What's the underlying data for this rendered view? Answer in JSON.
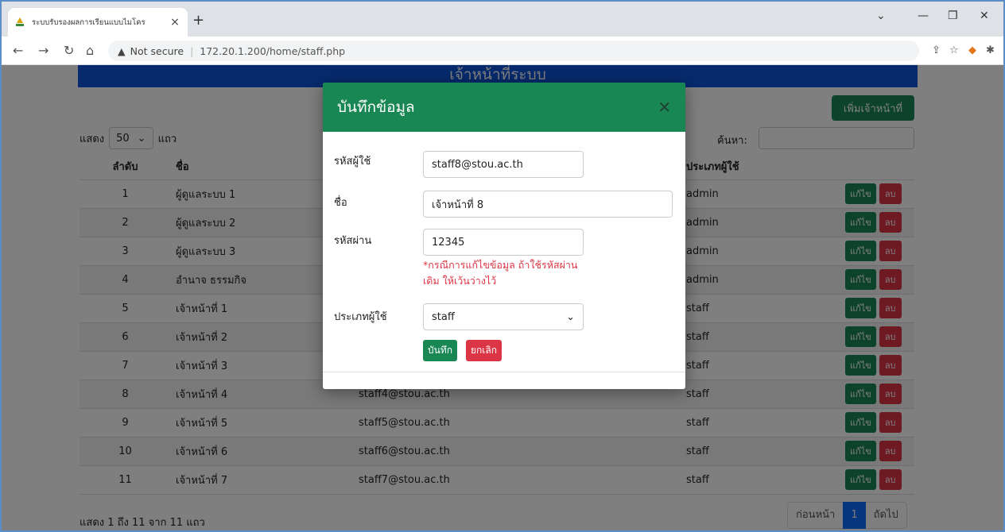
{
  "browser": {
    "tab_title": "ระบบรับรองผลการเรียนแบบไมโคร",
    "not_secure": "Not secure",
    "url": "172.20.1.200/home/staff.php"
  },
  "page": {
    "banner": "เจ้าหน้าที่ระบบ",
    "add_button": "เพิ่มเจ้าหน้าที่",
    "show_label": "แสดง",
    "page_length": "50",
    "rows_label": "แถว",
    "search_label": "ค้นหา:",
    "columns": [
      "ลำดับ",
      "ชื่อ",
      "",
      "ประเภทผู้ใช้"
    ],
    "edit_label": "แก้ไข",
    "delete_label": "ลบ",
    "rows": [
      {
        "no": "1",
        "name": "ผู้ดูแลระบบ 1",
        "email": "",
        "type": "admin"
      },
      {
        "no": "2",
        "name": "ผู้ดูแลระบบ 2",
        "email": "",
        "type": "admin"
      },
      {
        "no": "3",
        "name": "ผู้ดูแลระบบ 3",
        "email": "",
        "type": "admin"
      },
      {
        "no": "4",
        "name": "อำนาจ ธรรมกิจ",
        "email": "",
        "type": "admin"
      },
      {
        "no": "5",
        "name": "เจ้าหน้าที่ 1",
        "email": "",
        "type": "staff"
      },
      {
        "no": "6",
        "name": "เจ้าหน้าที่ 2",
        "email": "",
        "type": "staff"
      },
      {
        "no": "7",
        "name": "เจ้าหน้าที่ 3",
        "email": "",
        "type": "staff"
      },
      {
        "no": "8",
        "name": "เจ้าหน้าที่ 4",
        "email": "staff4@stou.ac.th",
        "type": "staff"
      },
      {
        "no": "9",
        "name": "เจ้าหน้าที่ 5",
        "email": "staff5@stou.ac.th",
        "type": "staff"
      },
      {
        "no": "10",
        "name": "เจ้าหน้าที่ 6",
        "email": "staff6@stou.ac.th",
        "type": "staff"
      },
      {
        "no": "11",
        "name": "เจ้าหน้าที่ 7",
        "email": "staff7@stou.ac.th",
        "type": "staff"
      }
    ],
    "info": "แสดง 1 ถึง 11 จาก 11 แถว",
    "pager": {
      "prev": "ก่อนหน้า",
      "current": "1",
      "next": "ถัดไป"
    }
  },
  "modal": {
    "title": "บันทึกข้อมูล",
    "username_label": "รหัสผู้ใช้",
    "username_value": "staff8@stou.ac.th",
    "name_label": "ชื่อ",
    "name_value": "เจ้าหน้าที่ 8",
    "password_label": "รหัสผ่าน",
    "password_value": "12345",
    "hint": "*กรณีการแก้ไขข้อมูล ถ้าใช้รหัสผ่านเดิม ให้เว้นว่างไว้",
    "usertype_label": "ประเภทผู้ใช้",
    "usertype_value": "staff",
    "save_label": "บันทึก",
    "cancel_label": "ยกเลิก"
  }
}
